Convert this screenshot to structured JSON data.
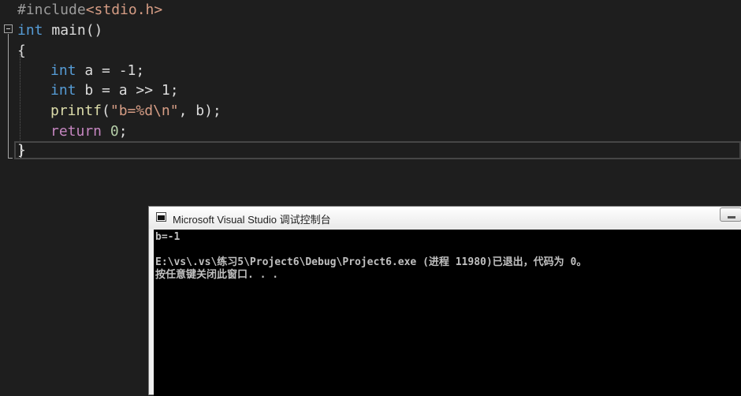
{
  "editor": {
    "lines": {
      "l1": {
        "directive": "#include",
        "header": "<stdio.h>"
      },
      "l2": {
        "type": "int",
        "name": " main()"
      },
      "l3": {
        "text": "{"
      },
      "l4": {
        "type": "int",
        "rest": " a = -1;"
      },
      "l5": {
        "type": "int",
        "rest": " b = a >> 1;"
      },
      "l6": {
        "fn": "printf",
        "open": "(",
        "str": "\"b=%d\\n\"",
        "rest": ", b);"
      },
      "l7": {
        "kw": "return",
        "space": " ",
        "num": "0",
        "end": ";"
      },
      "l8": {
        "text": "}"
      }
    },
    "colors": {
      "keyword": "#569cd6",
      "preprocessor": "#9b9b9b",
      "string": "#d69d85",
      "function": "#dcdcaa",
      "control": "#c586c0",
      "number": "#b5cea8"
    }
  },
  "console": {
    "title": "Microsoft Visual Studio 调试控制台",
    "output": [
      "b=-1",
      "",
      "E:\\vs\\.vs\\练习5\\Project6\\Debug\\Project6.exe (进程 11980)已退出，代码为 0。",
      "按任意键关闭此窗口. . ."
    ]
  }
}
